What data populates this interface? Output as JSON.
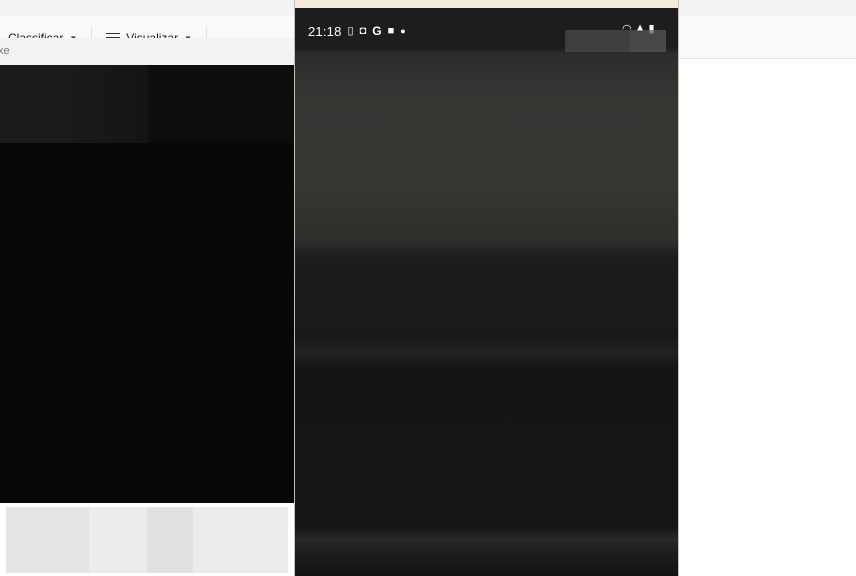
{
  "explorer": {
    "toolbar": {
      "sort_label": "Classificar",
      "view_label": "Visualizar",
      "more_label": "..."
    }
  },
  "console": {
    "title_fragment": "xe"
  },
  "phone": {
    "status_time": "21:18",
    "icons": [
      "sim-icon",
      "bag-icon",
      "google-icon",
      "note-icon",
      "dot-icon"
    ],
    "right_icons": [
      "wifi-icon",
      "signal-icon",
      "battery-icon"
    ]
  },
  "colors": {
    "console_bg": "#070707",
    "phone_bezel": "#f6eadb",
    "phone_screen": "#1d1d1d"
  }
}
